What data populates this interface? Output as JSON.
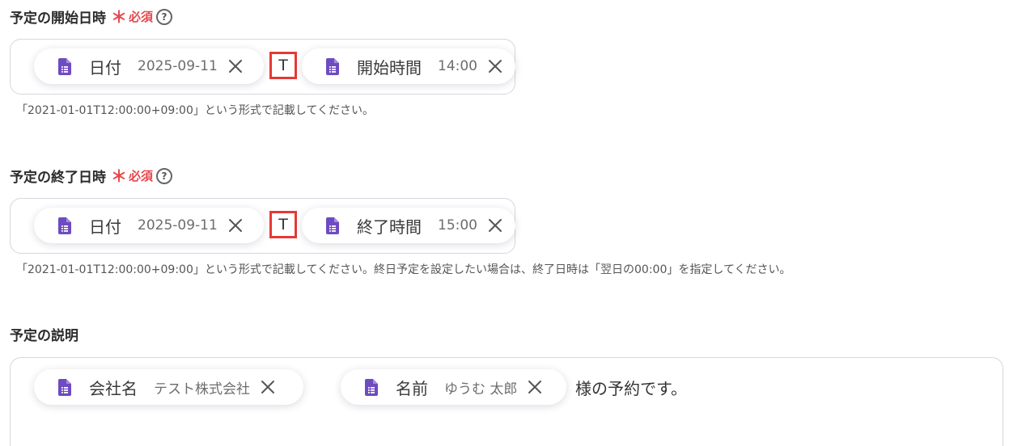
{
  "start_field": {
    "label": "予定の開始日時",
    "required_mark": "＊",
    "required_text": "必須",
    "help": "?",
    "date_chip": {
      "label": "日付",
      "value": "2025-09-11"
    },
    "separator": "T",
    "time_chip": {
      "label": "開始時間",
      "value": "14:00"
    },
    "hint": "「2021-01-01T12:00:00+09:00」という形式で記載してください。"
  },
  "end_field": {
    "label": "予定の終了日時",
    "required_mark": "＊",
    "required_text": "必須",
    "help": "?",
    "date_chip": {
      "label": "日付",
      "value": "2025-09-11"
    },
    "separator": "T",
    "time_chip": {
      "label": "終了時間",
      "value": "15:00"
    },
    "hint": "「2021-01-01T12:00:00+09:00」という形式で記載してください。終日予定を設定したい場合は、終了日時は「翌日の00:00」を指定してください。"
  },
  "description_field": {
    "label": "予定の説明",
    "company_chip": {
      "label": "会社名",
      "value": "テスト株式会社"
    },
    "name_chip": {
      "label": "名前",
      "value": "ゆうむ 太郎"
    },
    "suffix_text": "様の予約です。"
  },
  "colors": {
    "required": "#e5484d",
    "doc_icon": "#6f4bc2",
    "highlight_border": "#e53935",
    "field_border": "#d6d6df"
  },
  "icons": {
    "doc": "document-icon",
    "close": "close-icon",
    "help": "help-circle-icon"
  }
}
